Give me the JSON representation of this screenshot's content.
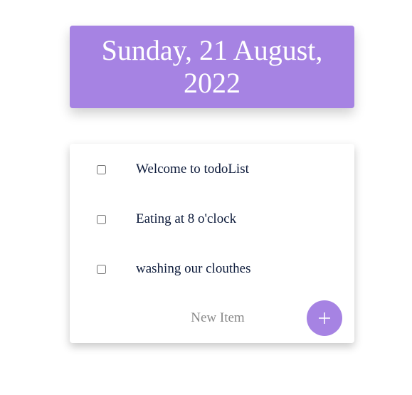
{
  "header": {
    "title": "Sunday, 21 August, 2022"
  },
  "todo_list": {
    "items": [
      {
        "label": "Welcome to todoList",
        "checked": false
      },
      {
        "label": "Eating at 8 o'clock",
        "checked": false
      },
      {
        "label": "washing our clouthes",
        "checked": false
      }
    ],
    "new_item": {
      "value": "",
      "placeholder": "New Item"
    },
    "add_button": {
      "icon": "plus-icon"
    }
  },
  "colors": {
    "accent": "#a683e3",
    "text": "#0c1a3a",
    "background": "#ffffff"
  }
}
